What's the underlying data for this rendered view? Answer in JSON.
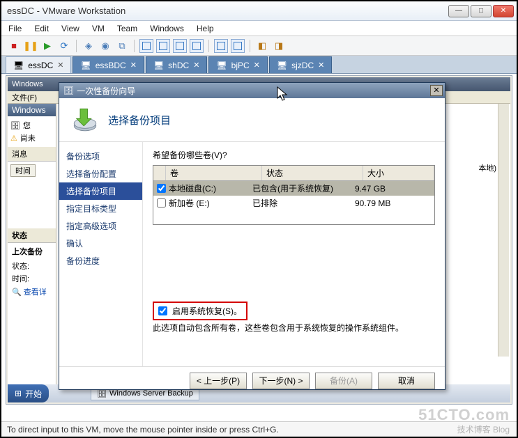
{
  "vmware": {
    "title": "essDC - VMware Workstation",
    "menu": [
      "File",
      "Edit",
      "View",
      "VM",
      "Team",
      "Windows",
      "Help"
    ],
    "tabs": [
      {
        "label": "essDC",
        "active": true
      },
      {
        "label": "essBDC",
        "active": false
      },
      {
        "label": "shDC",
        "active": false
      },
      {
        "label": "bjPC",
        "active": false
      },
      {
        "label": "sjzDC",
        "active": false
      }
    ],
    "status": "To direct input to this VM, move the mouse pointer inside or press Ctrl+G."
  },
  "guest": {
    "titlebar": "Windows",
    "file_menu": "文件(F)",
    "panel_title": "Windows",
    "tree_root": "您",
    "tree_warn": "尚未",
    "msg_label": "消息",
    "time_header": "时间",
    "state_label": "状态",
    "last_backup": "上次备份",
    "state": "状态:",
    "time": "时间:",
    "view_detail": "查看详",
    "local_suffix": "本地)",
    "start": "开始",
    "task_app": "Windows Server Backup"
  },
  "wizard": {
    "title": "一次性备份向导",
    "header": "选择备份项目",
    "nav": [
      "备份选项",
      "选择备份配置",
      "选择备份项目",
      "指定目标类型",
      "指定高级选项",
      "确认",
      "备份进度"
    ],
    "nav_selected_index": 2,
    "prompt": "希望备份哪些卷(V)?",
    "columns": {
      "vol": "卷",
      "status": "状态",
      "size": "大小"
    },
    "rows": [
      {
        "checked": true,
        "vol": "本地磁盘(C:)",
        "status": "已包含(用于系统恢复)",
        "size": "9.47 GB",
        "selected": true
      },
      {
        "checked": false,
        "vol": "新加卷 (E:)",
        "status": "已排除",
        "size": "90.79 MB",
        "selected": false
      }
    ],
    "sys_restore_label": "启用系统恢复(S)。",
    "sys_restore_checked": true,
    "sys_restore_desc": "此选项自动包含所有卷，这些卷包含用于系统恢复的操作系统组件。",
    "buttons": {
      "back": "< 上一步(P)",
      "next": "下一步(N) >",
      "backup": "备份(A)",
      "cancel": "取消"
    }
  },
  "watermark": {
    "main": "51CTO.com",
    "sub": "技术博客  Blog"
  }
}
